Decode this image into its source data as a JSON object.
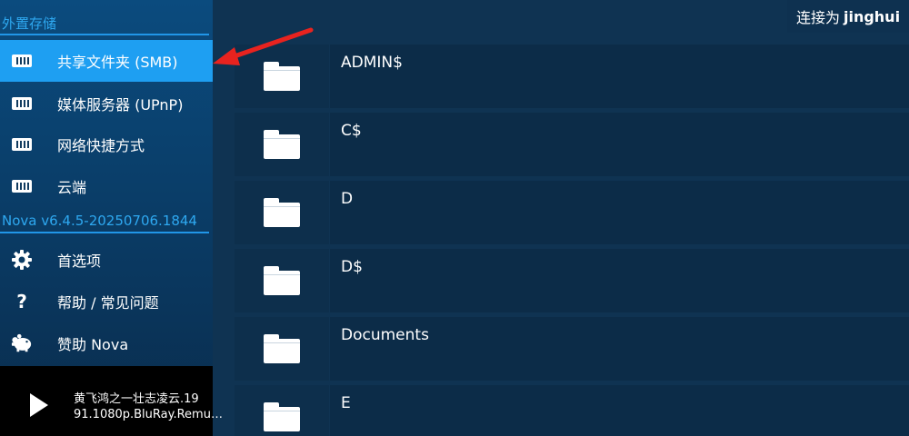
{
  "sidebar": {
    "storage_header": "外置存储",
    "items": [
      {
        "label": "共享文件夹 (SMB)",
        "icon": "network-drive-icon",
        "active": true
      },
      {
        "label": "媒体服务器 (UPnP)",
        "icon": "network-drive-icon"
      },
      {
        "label": "网络快捷方式",
        "icon": "network-drive-icon"
      },
      {
        "label": "云端",
        "icon": "network-drive-icon"
      }
    ],
    "version_header": "Nova v6.4.5-20250706.1844",
    "menu": [
      {
        "label": "首选项",
        "icon": "gear-icon"
      },
      {
        "label": "帮助 / 常见问题",
        "icon": "help-icon"
      },
      {
        "label": "赞助 Nova",
        "icon": "piggy-bank-icon"
      }
    ]
  },
  "player": {
    "title": "黄飞鸿之一壮志凌云.19\n91.1080p.BluRay.Remu…"
  },
  "header": {
    "connection_prefix": "连接为",
    "connection_user": "jinghui"
  },
  "files": [
    {
      "name": "ADMIN$"
    },
    {
      "name": "C$"
    },
    {
      "name": "D"
    },
    {
      "name": "D$"
    },
    {
      "name": "Documents"
    },
    {
      "name": "E"
    }
  ],
  "colors": {
    "accent": "#1e9ff2",
    "annotation_arrow": "#e8231f"
  }
}
